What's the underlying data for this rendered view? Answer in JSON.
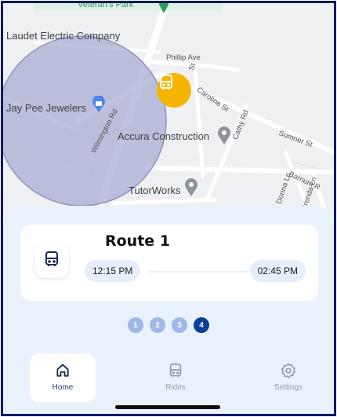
{
  "map": {
    "labels": {
      "park": "Veteran's Park",
      "electric": "Laudet Electric Company",
      "phillip": "Phillip Ave",
      "jewelers": "Jay Pee Jewelers",
      "wilmington": "Wilmington Rd",
      "caroline": "Caroline St",
      "st_small": "St",
      "cathy": "Cathy Rd",
      "accura": "Accura Construction",
      "sumner": "Sumner St",
      "barnum": "Barnum R",
      "tutor": "TutorWorks",
      "donna": "Donna Ln",
      "brenda": "Brenda Ln"
    },
    "colors": {
      "bus_marker": "#f5b400",
      "radius_fill": "#a9aed2",
      "poi_gray": "#8d939c",
      "poi_blue": "#4f86e8",
      "park_green": "#2e9e62"
    }
  },
  "route": {
    "title": "Route 1",
    "start_time": "12:15 PM",
    "end_time": "02:45 PM",
    "icon": "bus-icon"
  },
  "pager": [
    {
      "label": "1",
      "active": false
    },
    {
      "label": "2",
      "active": false
    },
    {
      "label": "3",
      "active": false
    },
    {
      "label": "4",
      "active": true
    }
  ],
  "nav": {
    "home": {
      "label": "Home",
      "icon": "home-icon",
      "active": true
    },
    "rides": {
      "label": "Rides",
      "icon": "bus-icon",
      "active": false
    },
    "settings": {
      "label": "Settings",
      "icon": "gear-icon",
      "active": false
    }
  },
  "theme": {
    "accent": "#0b3f9b",
    "frame": "#0d1b63",
    "sheet": "#e9f1fc"
  }
}
